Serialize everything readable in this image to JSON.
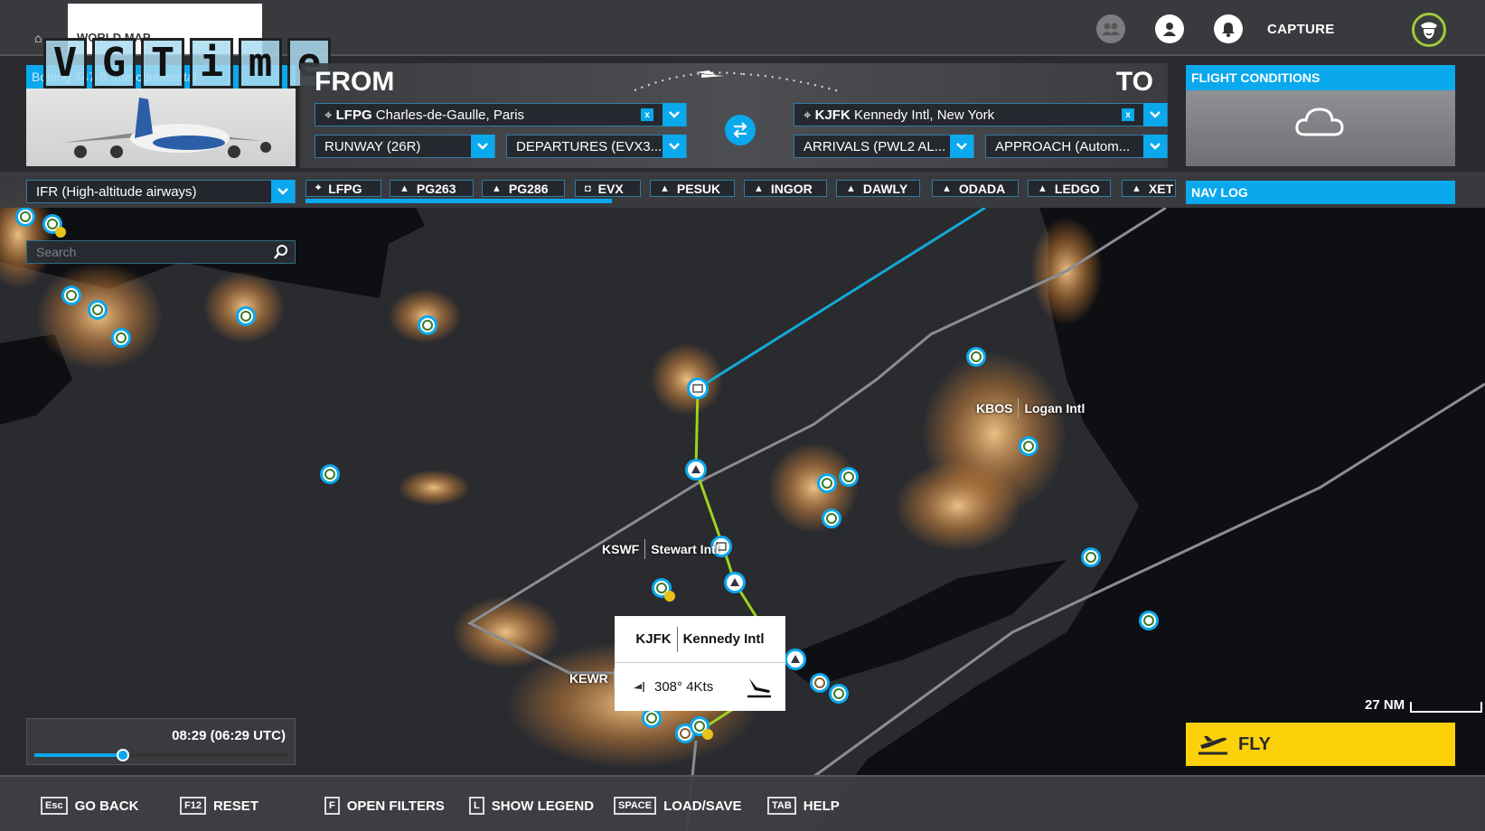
{
  "topbar": {
    "section_label": "WORLD MAP",
    "watermark": [
      "V",
      "G",
      "T",
      "i",
      "m",
      "e"
    ],
    "capture_label": "CAPTURE",
    "icons": [
      "friends-icon",
      "profile-icon",
      "notifications-icon",
      "pilot-avatar-icon"
    ]
  },
  "aircraft": {
    "name": "Boeing 747-8 Intercontinental"
  },
  "route": {
    "from_title": "FROM",
    "to_title": "TO",
    "departure": {
      "code": "LFPG",
      "name": "Charles-de-Gaulle, Paris"
    },
    "arrival": {
      "code": "KJFK",
      "name": "Kennedy Intl, New York"
    },
    "runway": "RUNWAY (26R)",
    "departures": "DEPARTURES (EVX3...",
    "arrivals": "ARRIVALS (PWL2 AL...",
    "approach": "APPROACH (Autom...",
    "clear_label": "x"
  },
  "conditions": {
    "title": "FLIGHT CONDITIONS",
    "weather_icon": "cloud-icon"
  },
  "flight_mode": "IFR (High-altitude airways)",
  "waypoints": [
    {
      "id": "LFPG",
      "type": "airport"
    },
    {
      "id": "PG263",
      "type": "waypoint"
    },
    {
      "id": "PG286",
      "type": "waypoint"
    },
    {
      "id": "EVX",
      "type": "vor"
    },
    {
      "id": "PESUK",
      "type": "waypoint"
    },
    {
      "id": "INGOR",
      "type": "waypoint"
    },
    {
      "id": "DAWLY",
      "type": "waypoint"
    },
    {
      "id": "ODADA",
      "type": "waypoint"
    },
    {
      "id": "LEDGO",
      "type": "waypoint"
    },
    {
      "id": "XET",
      "type": "waypoint"
    }
  ],
  "navlog_title": "NAV LOG",
  "search": {
    "placeholder": "Search"
  },
  "map_labels": [
    {
      "code": "KBOS",
      "name": "Logan Intl"
    },
    {
      "code": "KSWF",
      "name": "Stewart Intl"
    },
    {
      "code": "KEWR",
      "name": ""
    }
  ],
  "popup": {
    "code": "KJFK",
    "name": "Kennedy Intl",
    "wind": "308° 4Kts"
  },
  "time": {
    "display": "08:29 (06:29 UTC)",
    "slider_fraction": 0.35
  },
  "scale_label": "27 NM",
  "fly_label": "FLY",
  "hints": [
    {
      "key": "Esc",
      "label": "GO BACK"
    },
    {
      "key": "F12",
      "label": "RESET"
    },
    {
      "key": "F",
      "label": "OPEN FILTERS"
    },
    {
      "key": "L",
      "label": "SHOW LEGEND"
    },
    {
      "key": "SPACE",
      "label": "LOAD/SAVE"
    },
    {
      "key": "TAB",
      "label": "HELP"
    }
  ],
  "colors": {
    "accent": "#0aa8ec",
    "fly": "#fdd10a",
    "route_green": "#9fd21e",
    "route_blue": "#14a9d6",
    "boundary": "#8a8d92"
  }
}
